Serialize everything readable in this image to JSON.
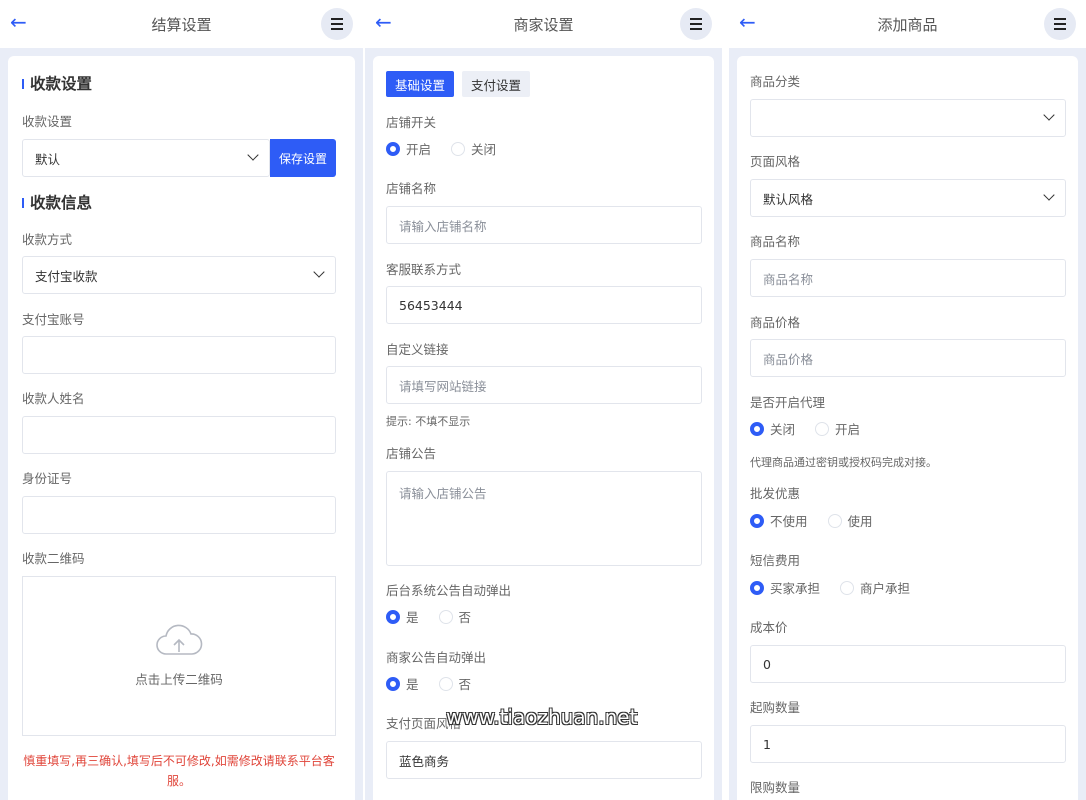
{
  "colors": {
    "accent": "#2e5cf6",
    "warning": "#e0453a",
    "page_bg": "#e9edf7"
  },
  "icons": {
    "back": "arrow-left-icon",
    "menu": "hamburger-menu-icon",
    "upload": "cloud-upload-icon",
    "select": "chevron-down-icon"
  },
  "panel1": {
    "title": "结算设置",
    "section_collect": "收款设置",
    "collect_label": "收款设置",
    "collect_value": "默认",
    "save_button": "保存设置",
    "section_info": "收款信息",
    "method_label": "收款方式",
    "method_value": "支付宝收款",
    "alipay_label": "支付宝账号",
    "name_label": "收款人姓名",
    "id_label": "身份证号",
    "qr_label": "收款二维码",
    "upload_text": "点击上传二维码",
    "warning": "慎重填写,再三确认,填写后不可修改,如需修改请联系平台客服。"
  },
  "panel2": {
    "title": "商家设置",
    "tab_basic": "基础设置",
    "tab_pay": "支付设置",
    "switch_label": "店铺开关",
    "switch_on": "开启",
    "switch_off": "关闭",
    "shopname_label": "店铺名称",
    "shopname_placeholder": "请输入店铺名称",
    "contact_label": "客服联系方式",
    "contact_value": "56453444",
    "link_label": "自定义链接",
    "link_placeholder": "请填写网站链接",
    "link_hint": "提示: 不填不显示",
    "notice_label": "店铺公告",
    "notice_placeholder": "请输入店铺公告",
    "sys_popup_label": "后台系统公告自动弹出",
    "sys_yes": "是",
    "sys_no": "否",
    "shop_popup_label": "商家公告自动弹出",
    "shop_yes": "是",
    "shop_no": "否",
    "paystyle_label": "支付页面风格",
    "paystyle_value": "蓝色商务"
  },
  "panel3": {
    "title": "添加商品",
    "category_label": "商品分类",
    "category_value": "",
    "style_label": "页面风格",
    "style_value": "默认风格",
    "name_label": "商品名称",
    "name_placeholder": "商品名称",
    "price_label": "商品价格",
    "price_placeholder": "商品价格",
    "agent_label": "是否开启代理",
    "agent_off": "关闭",
    "agent_on": "开启",
    "agent_hint": "代理商品通过密钥或授权码完成对接。",
    "wholesale_label": "批发优惠",
    "wholesale_no": "不使用",
    "wholesale_yes": "使用",
    "sms_label": "短信费用",
    "sms_buyer": "买家承担",
    "sms_merchant": "商户承担",
    "cost_label": "成本价",
    "cost_value": "0",
    "min_label": "起购数量",
    "min_value": "1",
    "limit_label": "限购数量"
  },
  "watermark": "www.tiaozhuan.net"
}
